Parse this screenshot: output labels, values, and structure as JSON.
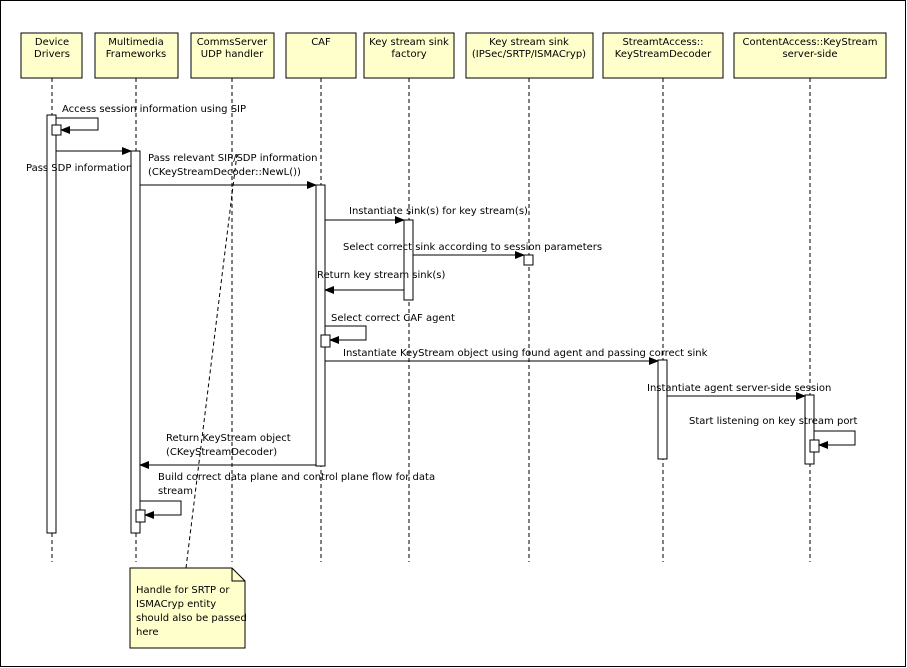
{
  "participants": [
    {
      "lines": [
        "Device",
        "Drivers"
      ]
    },
    {
      "lines": [
        "Multimedia",
        "Frameworks"
      ]
    },
    {
      "lines": [
        "CommsServer",
        "UDP handler"
      ]
    },
    {
      "lines": [
        "CAF"
      ]
    },
    {
      "lines": [
        "Key stream sink",
        "factory"
      ]
    },
    {
      "lines": [
        "Key stream sink",
        "(IPSec/SRTP/ISMACryp)"
      ]
    },
    {
      "lines": [
        "StreamtAccess::",
        "KeyStreamDecoder"
      ]
    },
    {
      "lines": [
        "ContentAccess::KeyStream",
        "server-side"
      ]
    }
  ],
  "messages": [
    {
      "lines": [
        "Access session information using SIP"
      ]
    },
    {
      "lines": [
        "Pass SDP information"
      ]
    },
    {
      "lines": [
        "Pass relevant SIP/SDP information",
        "(CKeyStreamDecoder::NewL())"
      ]
    },
    {
      "lines": [
        "Instantiate sink(s) for key stream(s)"
      ]
    },
    {
      "lines": [
        "Select correct sink according to session parameters"
      ]
    },
    {
      "lines": [
        "Return key stream sink(s)"
      ]
    },
    {
      "lines": [
        "Select correct CAF agent"
      ]
    },
    {
      "lines": [
        "Instantiate KeyStream object using found agent and passing correct sink"
      ]
    },
    {
      "lines": [
        "Instantiate agent server-side session"
      ]
    },
    {
      "lines": [
        "Start listening on key stream port"
      ]
    },
    {
      "lines": [
        "Return KeyStream object",
        "(CKeyStreamDecoder)"
      ]
    },
    {
      "lines": [
        "Build correct data plane and control plane flow for data",
        "stream"
      ]
    }
  ],
  "note": {
    "lines": [
      "Handle for SRTP or",
      "ISMACryp entity",
      "should also be passed",
      "here"
    ]
  },
  "colors": {
    "box_fill": "#ffffcc",
    "note_fill": "#ffffcc",
    "stroke": "#000000"
  }
}
